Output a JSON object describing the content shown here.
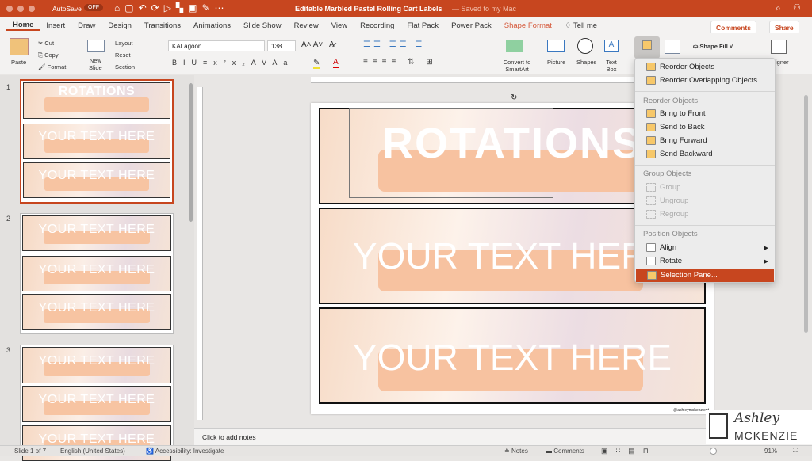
{
  "titlebar": {
    "autosave": "AutoSave",
    "autosave_state": "OFF",
    "title": "Editable Marbled Pastel Rolling Cart Labels",
    "saved": "— Saved to my Mac"
  },
  "tabs": [
    "Home",
    "Insert",
    "Draw",
    "Design",
    "Transitions",
    "Animations",
    "Slide Show",
    "Review",
    "View",
    "Recording",
    "Flat Pack",
    "Power Pack",
    "Shape Format"
  ],
  "tell_me": "Tell me",
  "comments_btn": "Comments",
  "share_btn": "Share",
  "ribbon": {
    "paste": "Paste",
    "cut": "Cut",
    "copy": "Copy",
    "format": "Format",
    "new_slide": "New\nSlide",
    "layout": "Layout",
    "reset": "Reset",
    "section": "Section",
    "font": "KALagoon",
    "size": "138",
    "convert": "Convert to SmartArt",
    "picture": "Picture",
    "shapes": "Shapes",
    "textbox": "Text Box",
    "shape_fill": "Shape Fill",
    "designer": "igner"
  },
  "slides": {
    "numbers": [
      "1",
      "2",
      "3"
    ],
    "title_text": "ROTATIONS",
    "body_text": "YOUR TEXT HERE"
  },
  "slide": {
    "title": "ROTATIONS",
    "label2": "YOUR TEXT HERE",
    "label3": "YOUR TEXT HERE",
    "credit": "@ashleymckenziept"
  },
  "menu": {
    "items_top": [
      "Reorder Objects",
      "Reorder Overlapping Objects"
    ],
    "h1": "Reorder Objects",
    "reorder": [
      "Bring to Front",
      "Send to Back",
      "Bring Forward",
      "Send Backward"
    ],
    "h2": "Group Objects",
    "group": [
      "Group",
      "Ungroup",
      "Regroup"
    ],
    "h3": "Position Objects",
    "position": [
      "Align",
      "Rotate",
      "Selection Pane..."
    ]
  },
  "notes": "Click to add notes",
  "logo": {
    "line1": "Ashley",
    "line2": "MCKENZIE"
  },
  "status": {
    "slide": "Slide 1 of 7",
    "lang": "English (United States)",
    "access": "Accessibility: Investigate",
    "notes": "Notes",
    "comments": "Comments",
    "zoom": "91%",
    "zoom_level": 91
  },
  "colors": {
    "accent": "#c7461f",
    "peach": "#f7c2a0"
  }
}
